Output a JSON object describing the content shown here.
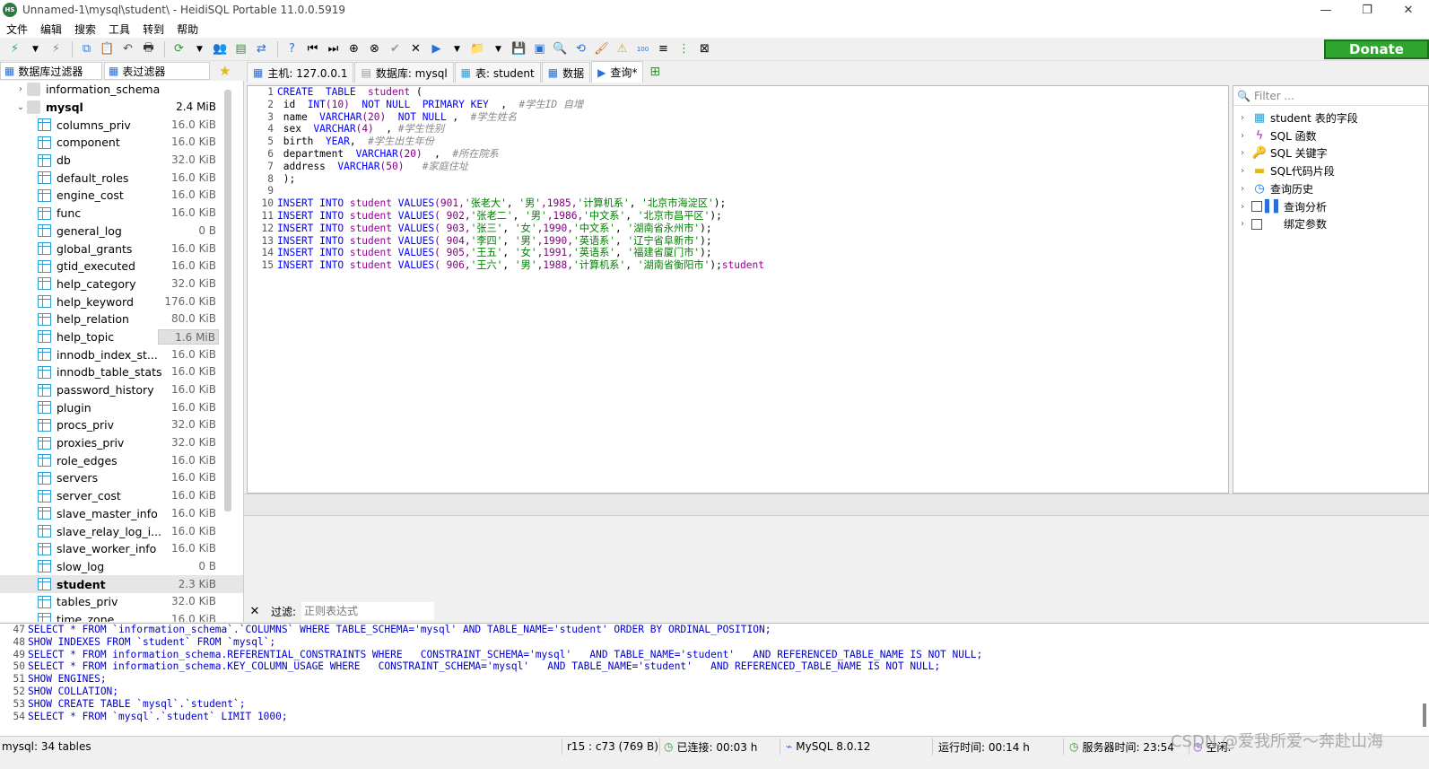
{
  "window": {
    "title": "Unnamed-1\\mysql\\student\\ - HeidiSQL Portable 11.0.0.5919",
    "logo_text": "HS",
    "min": "—",
    "max": "❐",
    "close": "✕"
  },
  "menu": [
    "文件",
    "编辑",
    "搜索",
    "工具",
    "转到",
    "帮助"
  ],
  "donate_label": "Donate",
  "left_filters": {
    "db_filter": "数据库过滤器",
    "table_filter": "表过滤器"
  },
  "tabs": [
    {
      "label": "主机: 127.0.0.1",
      "icon": "server-icon"
    },
    {
      "label": "数据库: mysql",
      "icon": "database-icon"
    },
    {
      "label": "表: student",
      "icon": "table-icon"
    },
    {
      "label": "数据",
      "icon": "grid-icon"
    },
    {
      "label": "查询*",
      "icon": "play-icon"
    }
  ],
  "tree": {
    "dbs": [
      {
        "name": "information_schema",
        "expanded": false
      },
      {
        "name": "mysql",
        "size": "2.4 MiB",
        "expanded": true
      }
    ],
    "tables": [
      {
        "name": "columns_priv",
        "size": "16.0 KiB"
      },
      {
        "name": "component",
        "size": "16.0 KiB"
      },
      {
        "name": "db",
        "size": "32.0 KiB"
      },
      {
        "name": "default_roles",
        "size": "16.0 KiB"
      },
      {
        "name": "engine_cost",
        "size": "16.0 KiB"
      },
      {
        "name": "func",
        "size": "16.0 KiB"
      },
      {
        "name": "general_log",
        "size": "0 B"
      },
      {
        "name": "global_grants",
        "size": "16.0 KiB"
      },
      {
        "name": "gtid_executed",
        "size": "16.0 KiB"
      },
      {
        "name": "help_category",
        "size": "32.0 KiB"
      },
      {
        "name": "help_keyword",
        "size": "176.0 KiB"
      },
      {
        "name": "help_relation",
        "size": "80.0 KiB"
      },
      {
        "name": "help_topic",
        "size": "1.6 MiB"
      },
      {
        "name": "innodb_index_st...",
        "size": "16.0 KiB"
      },
      {
        "name": "innodb_table_stats",
        "size": "16.0 KiB"
      },
      {
        "name": "password_history",
        "size": "16.0 KiB"
      },
      {
        "name": "plugin",
        "size": "16.0 KiB"
      },
      {
        "name": "procs_priv",
        "size": "32.0 KiB"
      },
      {
        "name": "proxies_priv",
        "size": "32.0 KiB"
      },
      {
        "name": "role_edges",
        "size": "16.0 KiB"
      },
      {
        "name": "servers",
        "size": "16.0 KiB"
      },
      {
        "name": "server_cost",
        "size": "16.0 KiB"
      },
      {
        "name": "slave_master_info",
        "size": "16.0 KiB"
      },
      {
        "name": "slave_relay_log_i...",
        "size": "16.0 KiB"
      },
      {
        "name": "slave_worker_info",
        "size": "16.0 KiB"
      },
      {
        "name": "slow_log",
        "size": "0 B"
      },
      {
        "name": "student",
        "size": "2.3 KiB",
        "selected": true
      },
      {
        "name": "tables_priv",
        "size": "32.0 KiB"
      },
      {
        "name": "time_zone",
        "size": "16.0 KiB"
      }
    ]
  },
  "editor_lines": [
    [
      [
        "kw",
        "CREATE  TABLE  "
      ],
      [
        "id",
        "student"
      ],
      [
        "tx",
        " ("
      ]
    ],
    [
      [
        "tx",
        " id  "
      ],
      [
        "ty",
        "INT"
      ],
      [
        "nm",
        "(10)"
      ],
      [
        "tx",
        "  "
      ],
      [
        "kw",
        "NOT NULL  PRIMARY KEY"
      ],
      [
        "tx",
        "  ,  "
      ],
      [
        "cm",
        "#学生ID 自增"
      ]
    ],
    [
      [
        "tx",
        " name  "
      ],
      [
        "ty",
        "VARCHAR"
      ],
      [
        "nm",
        "(20)"
      ],
      [
        "tx",
        "  "
      ],
      [
        "kw",
        "NOT NULL"
      ],
      [
        "tx",
        " ,  "
      ],
      [
        "cm",
        "#学生姓名"
      ]
    ],
    [
      [
        "tx",
        " sex  "
      ],
      [
        "ty",
        "VARCHAR"
      ],
      [
        "nm",
        "(4)"
      ],
      [
        "tx",
        "  , "
      ],
      [
        "cm",
        "#学生性别"
      ]
    ],
    [
      [
        "tx",
        " birth  "
      ],
      [
        "ty",
        "YEAR"
      ],
      [
        "tx",
        ",  "
      ],
      [
        "cm",
        "#学生出生年份"
      ]
    ],
    [
      [
        "tx",
        " department  "
      ],
      [
        "ty",
        "VARCHAR"
      ],
      [
        "nm",
        "(20)"
      ],
      [
        "tx",
        "  ,  "
      ],
      [
        "cm",
        "#所在院系"
      ]
    ],
    [
      [
        "tx",
        " address  "
      ],
      [
        "ty",
        "VARCHAR"
      ],
      [
        "nm",
        "(50)"
      ],
      [
        "tx",
        "   "
      ],
      [
        "cm",
        "#家庭住址"
      ]
    ],
    [
      [
        "tx",
        " );"
      ]
    ],
    [
      [
        "tx",
        ""
      ]
    ],
    [
      [
        "kw",
        "INSERT INTO "
      ],
      [
        "id",
        "student"
      ],
      [
        "kw",
        " VALUES"
      ],
      [
        "nm",
        "(901,"
      ],
      [
        "str",
        "'张老大'"
      ],
      [
        "tx",
        ", "
      ],
      [
        "str",
        "'男'"
      ],
      [
        "nm",
        ",1985,"
      ],
      [
        "str",
        "'计算机系'"
      ],
      [
        "tx",
        ", "
      ],
      [
        "str",
        "'北京市海淀区'"
      ],
      [
        "tx",
        ");"
      ]
    ],
    [
      [
        "kw",
        "INSERT INTO "
      ],
      [
        "id",
        "student"
      ],
      [
        "kw",
        " VALUES"
      ],
      [
        "nm",
        "( 902,"
      ],
      [
        "str",
        "'张老二'"
      ],
      [
        "tx",
        ", "
      ],
      [
        "str",
        "'男'"
      ],
      [
        "nm",
        ",1986,"
      ],
      [
        "str",
        "'中文系'"
      ],
      [
        "tx",
        ", "
      ],
      [
        "str",
        "'北京市昌平区'"
      ],
      [
        "tx",
        ");"
      ]
    ],
    [
      [
        "kw",
        "INSERT INTO "
      ],
      [
        "id",
        "student"
      ],
      [
        "kw",
        " VALUES"
      ],
      [
        "nm",
        "( 903,"
      ],
      [
        "str",
        "'张三'"
      ],
      [
        "tx",
        ", "
      ],
      [
        "str",
        "'女'"
      ],
      [
        "nm",
        ",1990,"
      ],
      [
        "str",
        "'中文系'"
      ],
      [
        "tx",
        ", "
      ],
      [
        "str",
        "'湖南省永州市'"
      ],
      [
        "tx",
        ");"
      ]
    ],
    [
      [
        "kw",
        "INSERT INTO "
      ],
      [
        "id",
        "student"
      ],
      [
        "kw",
        " VALUES"
      ],
      [
        "nm",
        "( 904,"
      ],
      [
        "str",
        "'李四'"
      ],
      [
        "tx",
        ", "
      ],
      [
        "str",
        "'男'"
      ],
      [
        "nm",
        ",1990,"
      ],
      [
        "str",
        "'英语系'"
      ],
      [
        "tx",
        ", "
      ],
      [
        "str",
        "'辽宁省阜新市'"
      ],
      [
        "tx",
        ");"
      ]
    ],
    [
      [
        "kw",
        "INSERT INTO "
      ],
      [
        "id",
        "student"
      ],
      [
        "kw",
        " VALUES"
      ],
      [
        "nm",
        "( 905,"
      ],
      [
        "str",
        "'王五'"
      ],
      [
        "tx",
        ", "
      ],
      [
        "str",
        "'女'"
      ],
      [
        "nm",
        ",1991,"
      ],
      [
        "str",
        "'英语系'"
      ],
      [
        "tx",
        ", "
      ],
      [
        "str",
        "'福建省厦门市'"
      ],
      [
        "tx",
        ");"
      ]
    ],
    [
      [
        "kw",
        "INSERT INTO "
      ],
      [
        "id",
        "student"
      ],
      [
        "kw",
        " VALUES"
      ],
      [
        "nm",
        "( 906,"
      ],
      [
        "str",
        "'王六'"
      ],
      [
        "tx",
        ", "
      ],
      [
        "str",
        "'男'"
      ],
      [
        "nm",
        ",1988,"
      ],
      [
        "str",
        "'计算机系'"
      ],
      [
        "tx",
        ", "
      ],
      [
        "str",
        "'湖南省衡阳市'"
      ],
      [
        "tx",
        ");"
      ],
      [
        "id",
        "student"
      ]
    ]
  ],
  "right_panel": {
    "filter_placeholder": "Filter ...",
    "items": [
      {
        "label": "student 表的字段",
        "icon": "table-icon"
      },
      {
        "label": "SQL 函数",
        "icon": "function-icon"
      },
      {
        "label": "SQL 关键字",
        "icon": "key-icon"
      },
      {
        "label": "SQL代码片段",
        "icon": "folder-icon"
      },
      {
        "label": "查询历史",
        "icon": "clock-icon"
      },
      {
        "label": "查询分析",
        "icon": "chart-icon",
        "checkbox": true
      },
      {
        "label": "绑定参数",
        "icon": "code-icon",
        "checkbox": true
      }
    ]
  },
  "filter_row": {
    "label": "过滤:",
    "placeholder": "正则表达式"
  },
  "log": [
    {
      "n": "47",
      "t": "SELECT * FROM `information_schema`.`COLUMNS` WHERE TABLE_SCHEMA='mysql' AND TABLE_NAME='student' ORDER BY ORDINAL_POSITION;"
    },
    {
      "n": "48",
      "t": "SHOW INDEXES FROM `student` FROM `mysql`;"
    },
    {
      "n": "49",
      "t": "SELECT * FROM information_schema.REFERENTIAL_CONSTRAINTS WHERE   CONSTRAINT_SCHEMA='mysql'   AND TABLE_NAME='student'   AND REFERENCED_TABLE_NAME IS NOT NULL;"
    },
    {
      "n": "50",
      "t": "SELECT * FROM information_schema.KEY_COLUMN_USAGE WHERE   CONSTRAINT_SCHEMA='mysql'   AND TABLE_NAME='student'   AND REFERENCED_TABLE_NAME IS NOT NULL;"
    },
    {
      "n": "51",
      "t": "SHOW ENGINES;"
    },
    {
      "n": "52",
      "t": "SHOW COLLATION;"
    },
    {
      "n": "53",
      "t": "SHOW CREATE TABLE `mysql`.`student`;"
    },
    {
      "n": "54",
      "t": "SELECT * FROM `mysql`.`student` LIMIT 1000;"
    }
  ],
  "status": {
    "tables": "mysql: 34 tables",
    "cursor": "r15 : c73 (769 B)",
    "connected": "已连接: 00:03 h",
    "server": "MySQL 8.0.12",
    "uptime": "运行时间: 00:14 h",
    "server_time": "服务器时间: 23:54",
    "idle": "空闲."
  },
  "watermark": "CSDN @爱我所爱～奔赴山海"
}
